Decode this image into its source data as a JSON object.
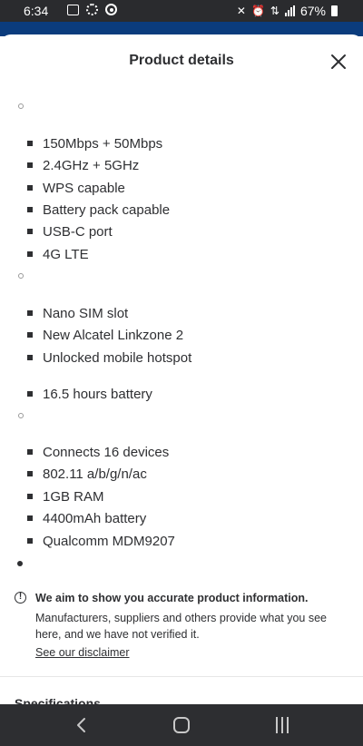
{
  "status_bar": {
    "time": "6:34",
    "battery": "67%",
    "left_icons": [
      "photo-icon",
      "fan-icon",
      "record-icon"
    ],
    "right_icons": [
      "mute-vibrate-icon",
      "alarm-icon",
      "data-icon",
      "signal-icon",
      "battery-icon"
    ]
  },
  "colors": {
    "accent_blue": "#0b3c7d",
    "status_bar": "#2a2b2e",
    "nav_bar": "#2d2e31",
    "text": "#2e2f32"
  },
  "modal": {
    "title": "Product details",
    "close_icon": "close-icon"
  },
  "details": {
    "group1": [
      "150Mbps + 50Mbps",
      "2.4GHz + 5GHz",
      "WPS capable",
      "Battery pack capable",
      "USB-C port",
      "4G LTE"
    ],
    "group2": [
      "Nano SIM slot",
      "New Alcatel Linkzone 2",
      "Unlocked mobile hotspot"
    ],
    "group3": [
      "16.5 hours battery"
    ],
    "group4": [
      "Connects 16 devices",
      "802.11 a/b/g/n/ac",
      "1GB RAM",
      "4400mAh battery",
      "Qualcomm MDM9207"
    ]
  },
  "notice": {
    "icon": "info-icon",
    "title": "We aim to show you accurate product information.",
    "body": "Manufacturers, suppliers and others provide what you see here, and we have not verified it.",
    "link": "See our disclaimer"
  },
  "next_section": "Specifications",
  "nav": {
    "back_icon": "back-icon",
    "home_icon": "home-icon",
    "recents_icon": "recents-icon"
  }
}
